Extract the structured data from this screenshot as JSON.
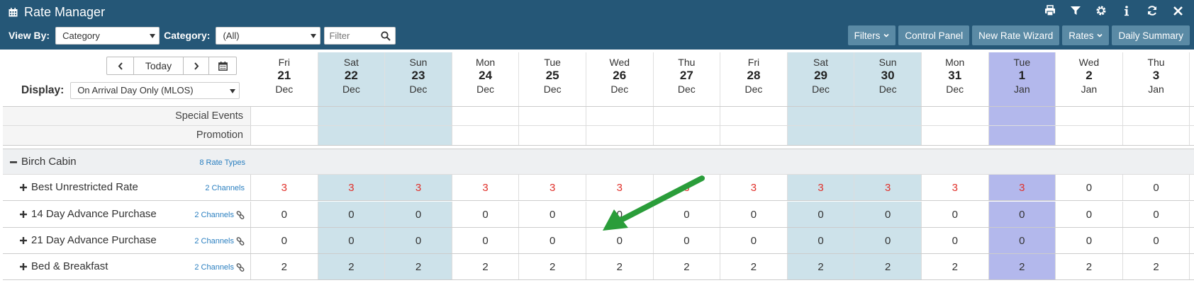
{
  "app": {
    "title": "Rate Manager"
  },
  "toolbar": {
    "view_by_label": "View By:",
    "view_by_value": "Category",
    "category_label": "Category:",
    "category_value": "(All)",
    "filter_placeholder": "Filter",
    "buttons": {
      "filters": "Filters",
      "control_panel": "Control Panel",
      "new_rate_wizard": "New Rate Wizard",
      "rates": "Rates",
      "daily_summary": "Daily Summary"
    }
  },
  "nav": {
    "today": "Today"
  },
  "display": {
    "label": "Display:",
    "value": "On Arrival Day Only (MLOS)"
  },
  "days": [
    {
      "dow": "Fri",
      "day": "21",
      "mon": "Dec",
      "type": "weekday"
    },
    {
      "dow": "Sat",
      "day": "22",
      "mon": "Dec",
      "type": "weekend"
    },
    {
      "dow": "Sun",
      "day": "23",
      "mon": "Dec",
      "type": "weekend"
    },
    {
      "dow": "Mon",
      "day": "24",
      "mon": "Dec",
      "type": "weekday"
    },
    {
      "dow": "Tue",
      "day": "25",
      "mon": "Dec",
      "type": "weekday"
    },
    {
      "dow": "Wed",
      "day": "26",
      "mon": "Dec",
      "type": "weekday"
    },
    {
      "dow": "Thu",
      "day": "27",
      "mon": "Dec",
      "type": "weekday"
    },
    {
      "dow": "Fri",
      "day": "28",
      "mon": "Dec",
      "type": "weekday"
    },
    {
      "dow": "Sat",
      "day": "29",
      "mon": "Dec",
      "type": "weekend"
    },
    {
      "dow": "Sun",
      "day": "30",
      "mon": "Dec",
      "type": "weekend"
    },
    {
      "dow": "Mon",
      "day": "31",
      "mon": "Dec",
      "type": "weekday"
    },
    {
      "dow": "Tue",
      "day": "1",
      "mon": "Jan",
      "type": "highlight"
    },
    {
      "dow": "Wed",
      "day": "2",
      "mon": "Jan",
      "type": "weekday"
    },
    {
      "dow": "Thu",
      "day": "3",
      "mon": "Jan",
      "type": "weekday"
    }
  ],
  "info_rows": {
    "special_events": "Special Events",
    "promotion": "Promotion"
  },
  "group": {
    "name": "Birch Cabin",
    "rate_types": "8 Rate Types"
  },
  "rates": [
    {
      "name": "Best Unrestricted Rate",
      "channels": "2 Channels",
      "linked": false,
      "values": [
        "3",
        "3",
        "3",
        "3",
        "3",
        "3",
        "3",
        "3",
        "3",
        "3",
        "3",
        "3",
        "0",
        "0"
      ],
      "red_count": 12
    },
    {
      "name": "14 Day Advance Purchase",
      "channels": "2 Channels",
      "linked": true,
      "values": [
        "0",
        "0",
        "0",
        "0",
        "0",
        "0",
        "0",
        "0",
        "0",
        "0",
        "0",
        "0",
        "0",
        "0"
      ],
      "red_count": 0
    },
    {
      "name": "21 Day Advance Purchase",
      "channels": "2 Channels",
      "linked": true,
      "values": [
        "0",
        "0",
        "0",
        "0",
        "0",
        "0",
        "0",
        "0",
        "0",
        "0",
        "0",
        "0",
        "0",
        "0"
      ],
      "red_count": 0
    },
    {
      "name": "Bed & Breakfast",
      "channels": "2 Channels",
      "linked": true,
      "values": [
        "2",
        "2",
        "2",
        "2",
        "2",
        "2",
        "2",
        "2",
        "2",
        "2",
        "2",
        "2",
        "2",
        "2"
      ],
      "red_count": 0
    }
  ],
  "colors": {
    "header": "#255777",
    "button": "#5a8aa5",
    "weekend": "#cde2ea",
    "highlight": "#b3b8ec",
    "red_value": "#e0302a",
    "arrow": "#2a9d3a"
  }
}
